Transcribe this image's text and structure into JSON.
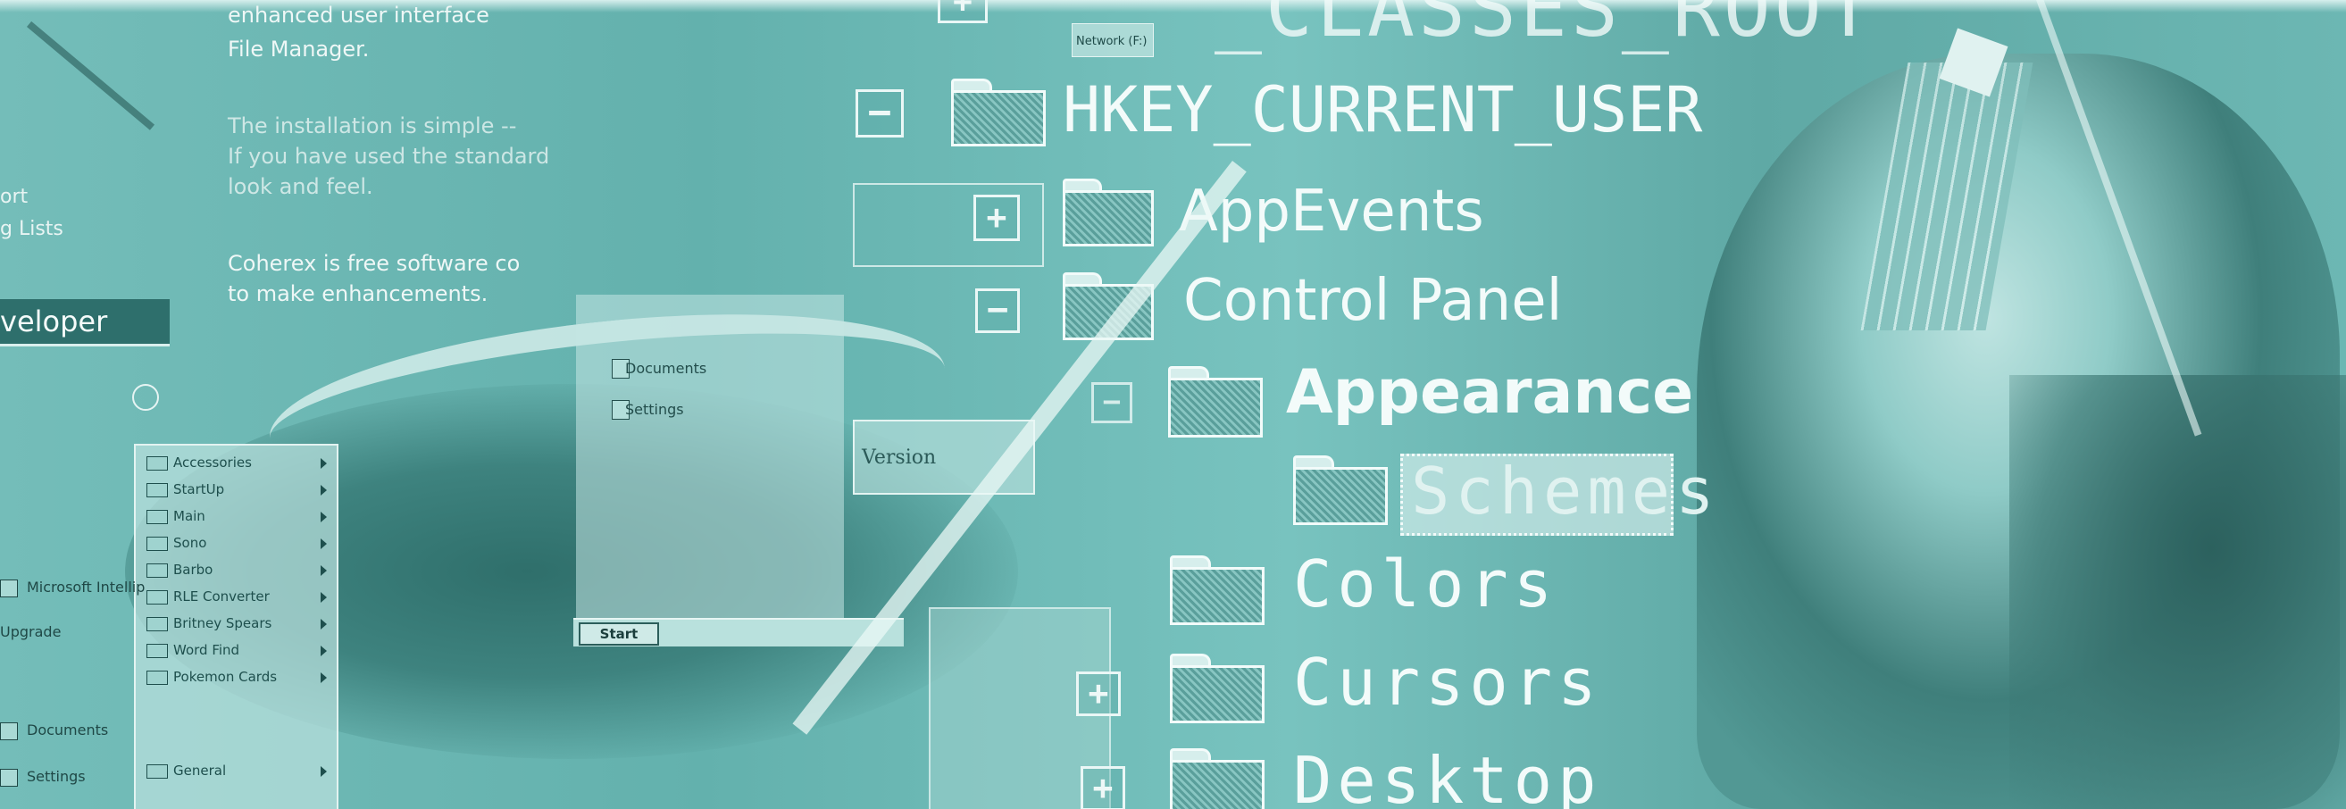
{
  "left_doc": {
    "line1": "enhanced user interface",
    "line2": "File Manager.",
    "line3": "The installation is simple --",
    "line4": "If you have used the standard",
    "line5": "look and feel.",
    "line6": "Coherex is free software co",
    "line7": "to make enhancements."
  },
  "left_side": {
    "item1": "ort",
    "item2": "g Lists"
  },
  "developer_bar": "veloper",
  "start_menu": {
    "main_items": [
      "Microsoft Intellip",
      "Upgrade",
      "Documents",
      "Settings"
    ],
    "submenu_items": [
      "Accessories",
      "StartUp",
      "Main",
      "Sono",
      "Barbo",
      "RLE Converter",
      "Britney Spears",
      "Word Find",
      "Pokemon Cards",
      "General"
    ]
  },
  "middle_menu": {
    "items": [
      "Documents",
      "Settings"
    ],
    "start_button": "Start",
    "network_label": "Network (F:)",
    "version_label": "Version"
  },
  "registry": {
    "top_key": "_CLASSES_ROOT",
    "user_key": "HKEY_CURRENT_USER",
    "app_events": "AppEvents",
    "control_panel": "Control Panel",
    "appearance": "Appearance",
    "schemes": "Schemes",
    "colors": "Colors",
    "cursors": "Cursors",
    "desktop": "Desktop"
  },
  "colors": {
    "tint": "#5fb0ac",
    "highlight": "#f3fbfa",
    "dark": "#234e4c"
  }
}
